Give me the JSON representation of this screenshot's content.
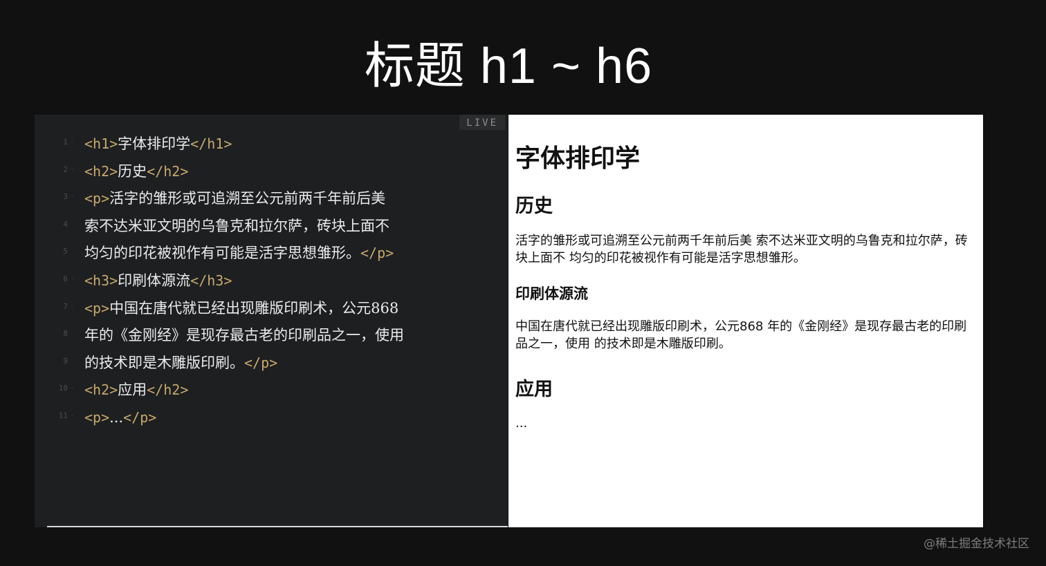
{
  "slide": {
    "title": "标题 h1 ~ h6"
  },
  "editor": {
    "live_label": "LIVE",
    "lines": [
      {
        "num": "1",
        "open": "<h1>",
        "text": "字体排印学",
        "close": "</h1>"
      },
      {
        "num": "2",
        "open": "<h2>",
        "text": "历史",
        "close": "</h2>"
      },
      {
        "num": "3",
        "open": "<p>",
        "text": "活字的雏形或可追溯至公元前两千年前后美",
        "close": ""
      },
      {
        "num": "4",
        "open": "",
        "text": "索不达米亚文明的乌鲁克和拉尔萨，砖块上面不",
        "close": ""
      },
      {
        "num": "5",
        "open": "",
        "text": "均匀的印花被视作有可能是活字思想雏形。",
        "close": "</p>"
      },
      {
        "num": "6",
        "open": "<h3>",
        "text": "印刷体源流",
        "close": "</h3>"
      },
      {
        "num": "7",
        "open": "<p>",
        "text": "中国在唐代就已经出现雕版印刷术，公元868",
        "close": ""
      },
      {
        "num": "8",
        "open": "",
        "text": "年的《金刚经》是现存最古老的印刷品之一，使用",
        "close": ""
      },
      {
        "num": "9",
        "open": "",
        "text": "的技术即是木雕版印刷。",
        "close": "</p>"
      },
      {
        "num": "10",
        "open": "<h2>",
        "text": "应用",
        "close": "</h2>"
      },
      {
        "num": "11",
        "open": "<p>",
        "text": "...",
        "close": "</p>"
      }
    ]
  },
  "preview": {
    "h1": "字体排印学",
    "h2_history": "历史",
    "p_history": "活字的雏形或可追溯至公元前两千年前后美 索不达米亚文明的乌鲁克和拉尔萨，砖块上面不 均匀的印花被视作有可能是活字思想雏形。",
    "h3": "印刷体源流",
    "p_print": "中国在唐代就已经出现雕版印刷术，公元868 年的《金刚经》是现存最古老的印刷品之一，使用 的技术即是木雕版印刷。",
    "h2_usage": "应用",
    "p_usage": "..."
  },
  "watermark": "@稀土掘金技术社区"
}
